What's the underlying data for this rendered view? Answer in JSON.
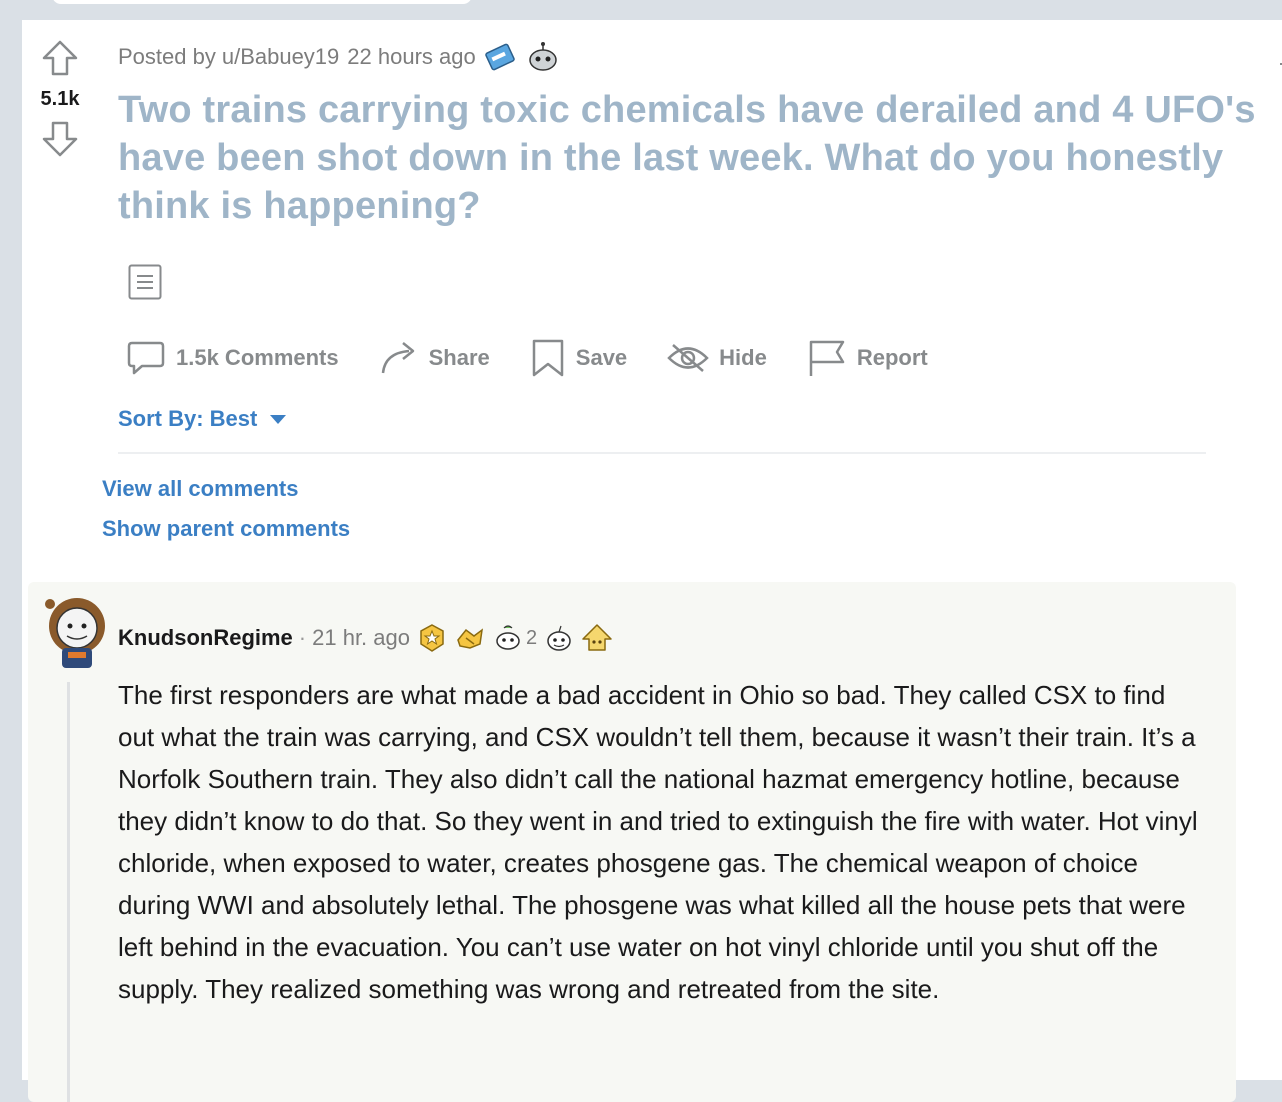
{
  "post": {
    "score": "5.1k",
    "posted_by_prefix": "Posted by",
    "author": "u/Babuey19",
    "time": "22 hours ago",
    "title": "Two trains carrying toxic chemicals have derailed and 4 UFO's have been shot down in the last week. What do you honestly think is happening?"
  },
  "actions": {
    "comments": "1.5k Comments",
    "share": "Share",
    "save": "Save",
    "hide": "Hide",
    "report": "Report"
  },
  "sort": {
    "label": "Sort By: Best"
  },
  "links": {
    "view_all": "View all comments",
    "show_parent": "Show parent comments"
  },
  "comment": {
    "username": "KnudsonRegime",
    "separator": "·",
    "time": "21 hr. ago",
    "award_count": "2",
    "body": "The first responders are what made a bad accident in Ohio so bad. They called CSX to find out what the train was carrying, and CSX wouldn’t tell them, because it wasn’t their train. It’s a Norfolk Southern train. They also didn’t call the national hazmat emergency hotline, because they didn’t know to do that. So they went in and tried to extinguish the fire with water. Hot vinyl chloride, when exposed to water, creates phosgene gas. The chemical weapon of choice during WWI and absolutely lethal. The phosgene was what killed all the house pets that were left behind in the evacuation. You can’t use water on hot vinyl chloride until you shut off the supply. They realized something was wrong and retreated from the site."
  },
  "colors": {
    "title": "#9fb5c8",
    "link": "#3b7fc4",
    "meta": "#7c7c7c",
    "action": "#878a8c"
  }
}
